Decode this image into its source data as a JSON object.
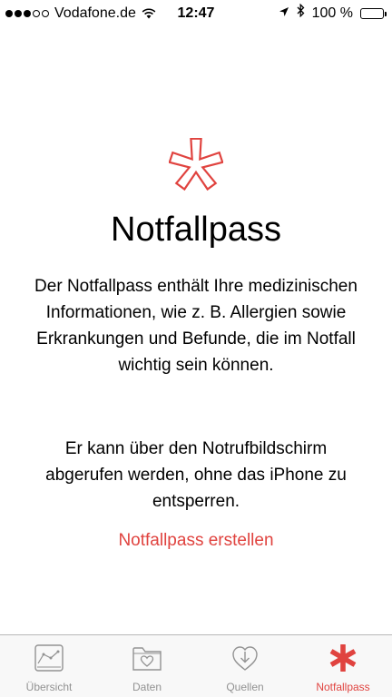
{
  "status_bar": {
    "carrier": "Vodafone.de",
    "time": "12:47",
    "battery": "100 %",
    "signal_bars_filled": 3,
    "signal_bars_total": 5
  },
  "main": {
    "title": "Notfallpass",
    "paragraph1": "Der Notfallpass enthält Ihre medizinischen Informationen, wie z. B. Allergien sowie Erkrankungen und Befunde, die im Notfall wichtig sein können.",
    "paragraph2": "Er kann über den Notrufbildschirm abgerufen werden, ohne das iPhone zu entsperren.",
    "create_link": "Notfallpass erstellen"
  },
  "tab_bar": {
    "tabs": [
      {
        "label": "Übersicht",
        "icon": "chart-icon",
        "active": false
      },
      {
        "label": "Daten",
        "icon": "heart-folder-icon",
        "active": false
      },
      {
        "label": "Quellen",
        "icon": "heart-download-icon",
        "active": false
      },
      {
        "label": "Notfallpass",
        "icon": "medical-asterisk-icon",
        "active": true
      }
    ]
  },
  "colors": {
    "accent": "#e0433f",
    "inactive": "#929292",
    "tab_bar_bg": "#f8f8f8"
  }
}
